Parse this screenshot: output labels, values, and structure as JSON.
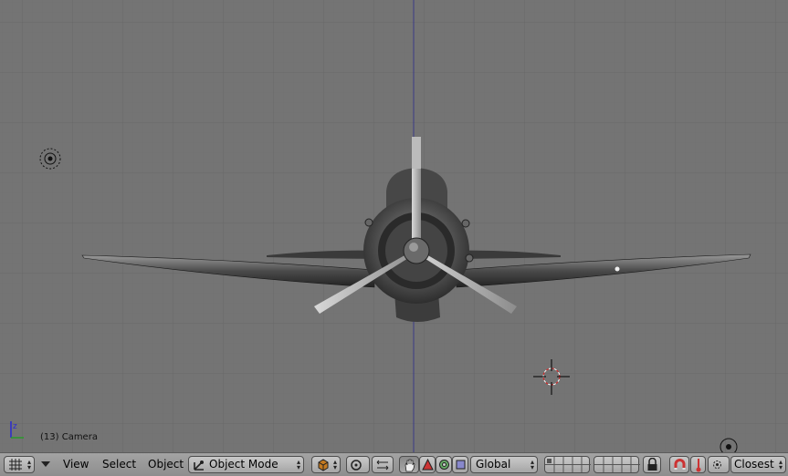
{
  "viewport": {
    "label": "(13) Camera",
    "background": "#747474",
    "grid_color": "#6a6a6a",
    "axis_color": "#3a3a7a"
  },
  "header": {
    "editor_type_icon": "view3d-icon",
    "menus": {
      "view": "View",
      "select": "Select",
      "object": "Object"
    },
    "mode": {
      "icon": "object-mode-icon",
      "label": "Object Mode"
    },
    "draw_type_icon": "solid-cube-icon",
    "pivot_icon": "pivot-icon",
    "orientation": "Global",
    "snap": "Closest"
  }
}
